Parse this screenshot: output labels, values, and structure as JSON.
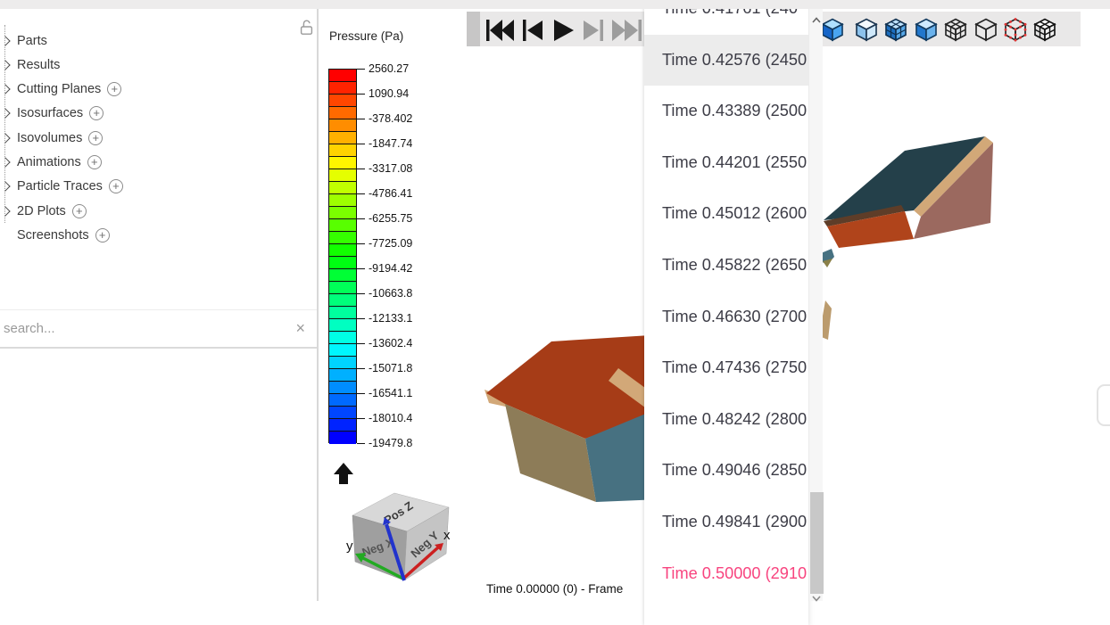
{
  "sidebar": {
    "tree": {
      "items": [
        {
          "label": "Parts",
          "chevron": true,
          "add": false
        },
        {
          "label": "Results",
          "chevron": true,
          "add": false
        },
        {
          "label": "Cutting Planes",
          "chevron": true,
          "add": true
        },
        {
          "label": "Isosurfaces",
          "chevron": true,
          "add": true
        },
        {
          "label": "Isovolumes",
          "chevron": true,
          "add": true
        },
        {
          "label": "Animations",
          "chevron": true,
          "add": true
        },
        {
          "label": "Particle Traces",
          "chevron": true,
          "add": true
        },
        {
          "label": "2D Plots",
          "chevron": true,
          "add": true
        },
        {
          "label": "Screenshots",
          "chevron": false,
          "add": true
        }
      ]
    },
    "search": {
      "placeholder": "search...",
      "clear_glyph": "×"
    }
  },
  "icons": {
    "add_glyph": "+",
    "lock": "open-padlock",
    "tree_chevron": "right-chevron",
    "scroll_up": "chevron-up",
    "scroll_down": "chevron-down"
  },
  "toolbar": {
    "playback": [
      {
        "name": "skip-to-start-button",
        "enabled": true
      },
      {
        "name": "step-back-button",
        "enabled": true
      },
      {
        "name": "play-button",
        "enabled": true
      },
      {
        "name": "step-forward-button",
        "enabled": false
      },
      {
        "name": "skip-to-end-button",
        "enabled": false
      }
    ],
    "view_cubes": [
      {
        "name": "cube-shaded-bright-icon",
        "kind": "shaded-bright"
      },
      {
        "name": "cube-shaded-light-icon",
        "kind": "shaded-light"
      },
      {
        "name": "cube-shaded-grid-icon",
        "kind": "shaded-grid"
      },
      {
        "name": "cube-shaded-icon",
        "kind": "shaded"
      },
      {
        "name": "cube-wireframe-grid-icon",
        "kind": "wire-grid"
      },
      {
        "name": "cube-wireframe-icon",
        "kind": "wire"
      },
      {
        "name": "cube-wireframe-points-icon",
        "kind": "wire-points"
      },
      {
        "name": "cube-grid-icon",
        "kind": "bw-grid"
      }
    ]
  },
  "chart_data": {
    "type": "colorbar-legend",
    "title": "Pressure (Pa)",
    "orientation": "vertical",
    "segments": 30,
    "scale": "rainbow red-to-blue",
    "color_top": "#ff0000",
    "color_bottom": "#0000ff",
    "range_max": 2560.27,
    "range_min": -19479.8,
    "tick_labels": [
      "2560.27",
      "1090.94",
      "-378.402",
      "-1847.74",
      "-3317.08",
      "-4786.41",
      "-6255.75",
      "-7725.09",
      "-9194.42",
      "-10663.8",
      "-12133.1",
      "-13602.4",
      "-15071.8",
      "-16541.1",
      "-18010.4",
      "-19479.8"
    ]
  },
  "time_dropdown": {
    "hovered_index": 1,
    "selected_index": 11,
    "selected_color": "#f8447f",
    "items": [
      {
        "label": "Time 0.41761 (240"
      },
      {
        "label": "Time 0.42576 (2450"
      },
      {
        "label": "Time 0.43389 (2500"
      },
      {
        "label": "Time 0.44201 (2550"
      },
      {
        "label": "Time 0.45012 (2600"
      },
      {
        "label": "Time 0.45822 (2650"
      },
      {
        "label": "Time 0.46630 (2700"
      },
      {
        "label": "Time 0.47436 (2750"
      },
      {
        "label": "Time 0.48242 (2800"
      },
      {
        "label": "Time 0.49046 (2850"
      },
      {
        "label": "Time 0.49841 (2900"
      },
      {
        "label": "Time 0.50000 (2910"
      }
    ]
  },
  "viewport": {
    "status_text": "Time 0.00000 (0) - Frame",
    "triad": {
      "top_face": "Pos Z",
      "left_face": "Neg X",
      "right_face": "Neg Y",
      "x_label": "x",
      "y_label": "y",
      "axis_colors": {
        "x": "#cc2020",
        "y": "#22aa22",
        "z": "#2233cc"
      }
    }
  },
  "scene": {
    "center_house": {
      "roof": "#a63c17",
      "left_wall": "#8d7c58",
      "right_wall": "#477181",
      "trim": "#d2a878"
    },
    "right_house": {
      "roof": "#24404a",
      "front_wall": "#9b695f",
      "left_wall": "#b0441b",
      "trim": "#d2a878",
      "under_eave": "#5e3d28"
    },
    "fragments": {
      "teal": "#477181",
      "olive": "#8a8048",
      "tan": "#bb9b6d"
    },
    "triad_faces": {
      "top": "#d8d8d8",
      "left": "#9f9f9f",
      "right": "#c4c4c4"
    }
  }
}
